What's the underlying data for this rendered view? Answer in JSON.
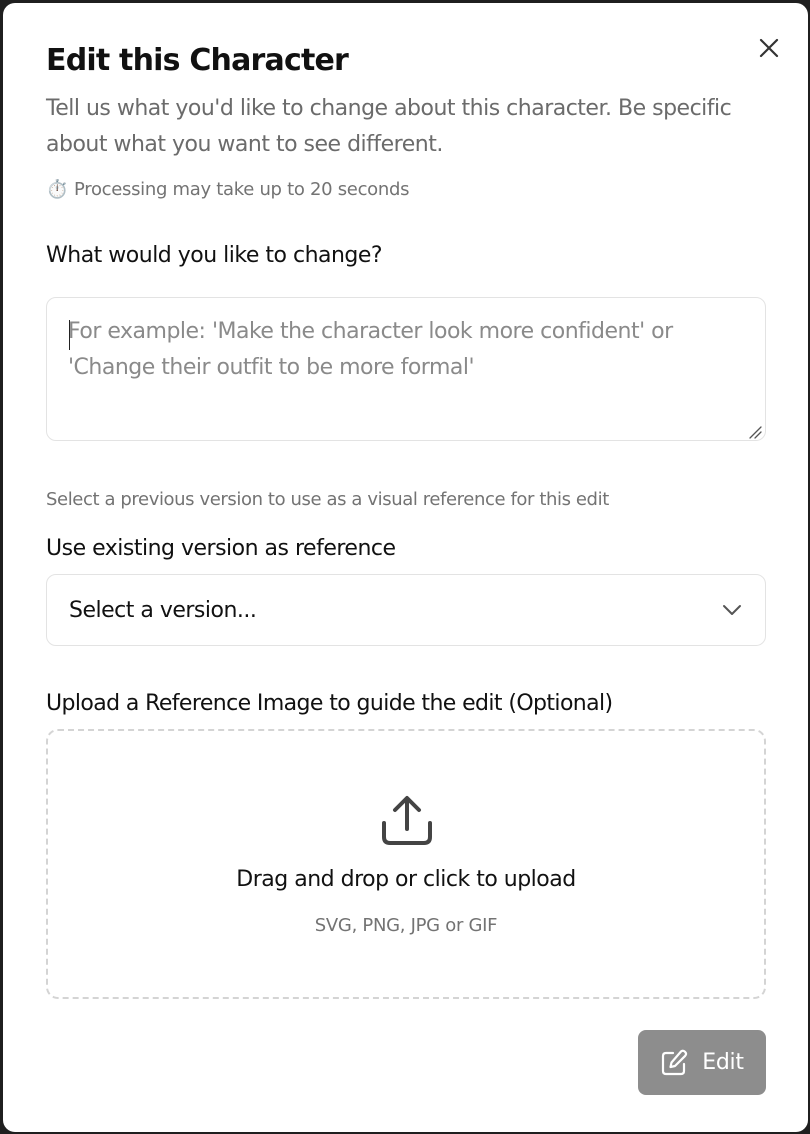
{
  "dialog": {
    "title": "Edit this Character",
    "description": "Tell us what you'd like to change about this character. Be specific about what you want to see different.",
    "processing_icon": "⏱️",
    "processing_note": "Processing may take up to 20 seconds",
    "close_icon": "close-icon"
  },
  "change_field": {
    "label": "What would you like to change?",
    "value": "",
    "placeholder": "For example: 'Make the character look more confident' or 'Change their outfit to be more formal'"
  },
  "reference_version": {
    "hint": "Select a previous version to use as a visual reference for this edit",
    "label": "Use existing version as reference",
    "selected_value": "Select a version...",
    "icon": "chevron-down-icon"
  },
  "upload": {
    "label": "Upload a Reference Image to guide the edit (Optional)",
    "prompt": "Drag and drop or click to upload",
    "formats": "SVG, PNG, JPG or GIF",
    "icon": "upload-icon"
  },
  "actions": {
    "edit_label": "Edit",
    "edit_icon": "edit-icon",
    "edit_button_color": "#8d8d8d"
  }
}
